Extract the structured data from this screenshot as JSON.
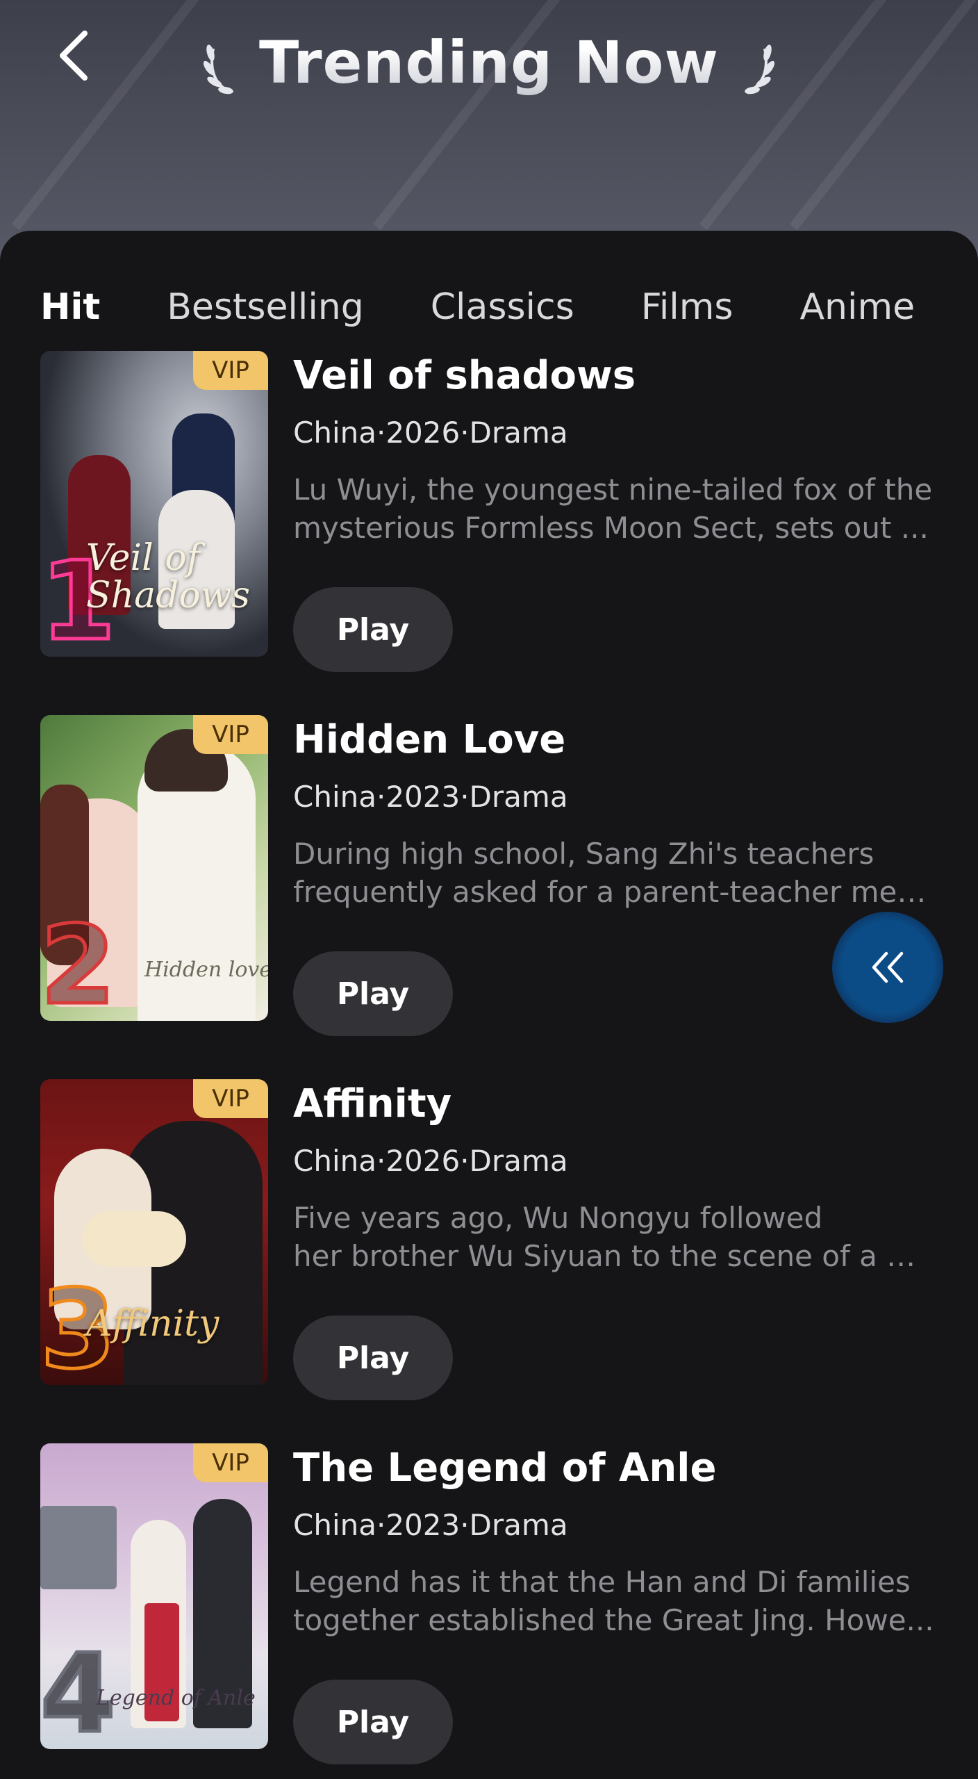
{
  "header": {
    "title": "Trending Now"
  },
  "tabs": [
    {
      "label": "Hit",
      "active": true
    },
    {
      "label": "Bestselling",
      "active": false
    },
    {
      "label": "Classics",
      "active": false
    },
    {
      "label": "Films",
      "active": false
    },
    {
      "label": "Anime",
      "active": false
    }
  ],
  "items": [
    {
      "rank": "1",
      "badge": "VIP",
      "poster_title": "Veil of Shadows",
      "title": "Veil of shadows",
      "meta": "China·2026·Drama",
      "desc_line1": "Lu Wuyi, the youngest nine-tailed fox of the",
      "desc_line2": "mysterious Formless Moon Sect, sets out ...",
      "play_label": "Play"
    },
    {
      "rank": "2",
      "badge": "VIP",
      "poster_title": "Hidden love",
      "title": "Hidden Love",
      "meta": "China·2023·Drama",
      "desc_line1": "During high school, Sang Zhi's teachers",
      "desc_line2": "frequently asked for a parent-teacher meet...",
      "play_label": "Play"
    },
    {
      "rank": "3",
      "badge": "VIP",
      "poster_title": "Affinity",
      "title": "Affinity",
      "meta": "China·2026·Drama",
      "desc_line1": "Five years ago, Wu Nongyu followed",
      "desc_line2": "her brother Wu Siyuan to the scene of a m...",
      "play_label": "Play"
    },
    {
      "rank": "4",
      "badge": "VIP",
      "poster_title": "Legend of Anle",
      "title": "The Legend of Anle",
      "meta": "China·2023·Drama",
      "desc_line1": "Legend has it that the Han and Di families",
      "desc_line2": "together established the Great Jing. Howe...",
      "play_label": "Play"
    }
  ],
  "icons": {
    "back": "chevron-left-icon",
    "laurel": "laurel-icon",
    "float": "double-chevron-left-icon"
  },
  "colors": {
    "background": "#151518",
    "vip_badge": "#f2c56a",
    "play_button": "#333337",
    "float_button": "#0b4c86"
  }
}
